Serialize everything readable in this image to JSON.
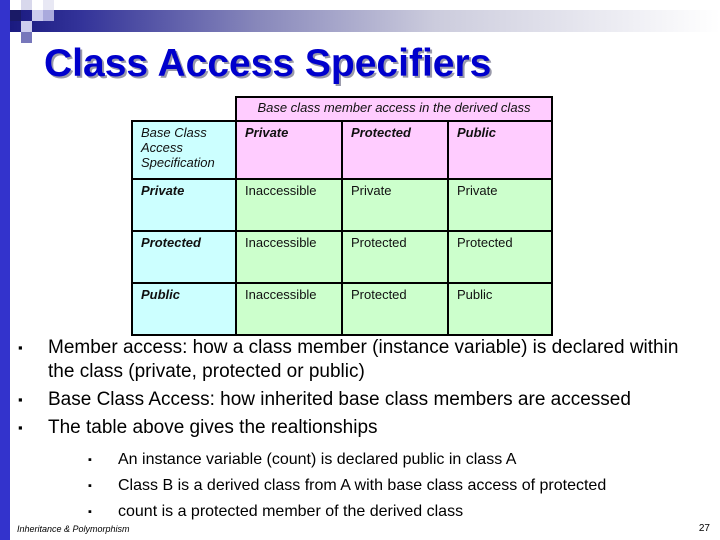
{
  "slide": {
    "title": "Class Access Specifiers",
    "page_number": "27",
    "footer": "Inheritance & Polymorphism"
  },
  "table": {
    "span_header": "Base class member access in the derived class",
    "corner_header": "Base Class Access Specification",
    "columns": [
      "Private",
      "Protected",
      "Public"
    ],
    "rows": [
      {
        "label": "Private",
        "cells": [
          "Inaccessible",
          "Private",
          "Private"
        ]
      },
      {
        "label": "Protected",
        "cells": [
          "Inaccessible",
          "Protected",
          "Protected"
        ]
      },
      {
        "label": "Public",
        "cells": [
          "Inaccessible",
          "Protected",
          "Public"
        ]
      }
    ]
  },
  "bullets": [
    "Member access: how a class member (instance variable) is declared within the class (private, protected or public)",
    "Base Class Access: how inherited base class members are accessed",
    "The table above gives the realtionships"
  ],
  "sub_bullets": [
    "An instance variable (count) is declared public in class A",
    "Class B is a derived class from A with base class access of protected",
    "count is a protected member of the derived class"
  ],
  "bullet_glyph": "▪",
  "colors": {
    "title": "#0000cc",
    "header_pink": "#ffccff",
    "row_cyan": "#ccffff",
    "cell_green": "#ccffcc",
    "accent_bar": "#3333cc"
  }
}
